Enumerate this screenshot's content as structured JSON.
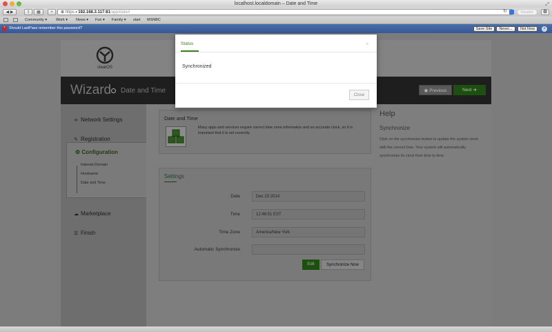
{
  "window": {
    "title": "localhost.localdomain – Date and Time"
  },
  "toolbar": {
    "url_scheme": "https",
    "url_host": "192.168.3.117:81",
    "url_path": "/app/date#",
    "reader_label": "Reader"
  },
  "bookmarks": [
    {
      "label": "Community ▾"
    },
    {
      "label": "Work ▾"
    },
    {
      "label": "News ▾"
    },
    {
      "label": "Fun ▾"
    },
    {
      "label": "Family ▾"
    },
    {
      "label": "start"
    },
    {
      "label": "MSNBC"
    }
  ],
  "lastpass": {
    "prompt": "Should LastPass remember this password?",
    "save_site": "Save Site",
    "never": "Never...",
    "not_now": "Not Now"
  },
  "header": {
    "logo_text": "clearOS"
  },
  "wizard": {
    "title": "Wizard",
    "subtitle": "Date and Time",
    "prev_label": "Previous",
    "next_label": "Next"
  },
  "sidebar": {
    "network": "Network Settings",
    "registration": "Registration",
    "configuration": "Configuration",
    "sub_items": [
      "Internet Domain",
      "Hostname",
      "Date and Time"
    ],
    "marketplace": "Marketplace",
    "finish": "Finish"
  },
  "datetime_panel": {
    "title": "Date and Time",
    "description": "Many apps and services require correct time zone information and an accurate clock, so it is important that it is set correctly."
  },
  "settings": {
    "title": "Settings",
    "rows": [
      {
        "label": "Date",
        "value": "Dec 23 2014"
      },
      {
        "label": "Time",
        "value": "12:46:51 EST"
      },
      {
        "label": "Time Zone",
        "value": "America/New York"
      },
      {
        "label": "Automatic Synchronize",
        "value": ""
      }
    ],
    "edit_label": "Edit",
    "sync_label": "Synchronize Now"
  },
  "help": {
    "title": "Help",
    "subtitle": "Synchronize",
    "text": "Click on the synchronize button to update the system clock with the correct time. Your system will automatically synchronize its clock from time to time."
  },
  "modal": {
    "title": "Status",
    "close_x": "×",
    "body": "Synchronized",
    "close_label": "Close"
  },
  "colors": {
    "accent_green": "#3e7d1e",
    "wizard_bar": "#1e1e1e",
    "lastpass_bar": "#4a6fa5"
  }
}
